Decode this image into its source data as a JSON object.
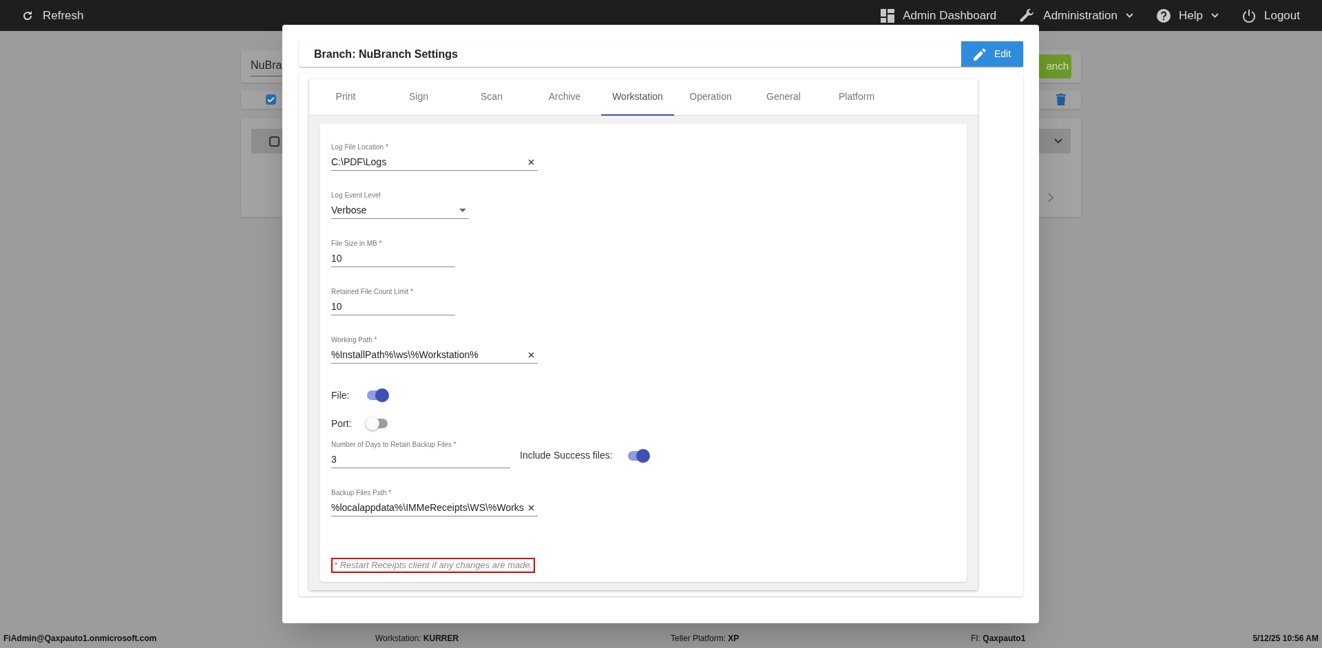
{
  "top_bar": {
    "refresh": "Refresh",
    "items": [
      {
        "kind": "dashboard",
        "label": "Admin Dashboard",
        "dropdown": false
      },
      {
        "kind": "wrench",
        "label": "Administration",
        "dropdown": true
      },
      {
        "kind": "help",
        "label": "Help",
        "dropdown": true
      },
      {
        "kind": "power",
        "label": "Logout",
        "dropdown": false
      }
    ]
  },
  "background": {
    "search_value": "NuBra",
    "button_label": "anch",
    "select_all_checked": true,
    "row_checked": false
  },
  "dialog": {
    "title": "Branch: NuBranch Settings",
    "edit_button": "Edit",
    "tabs": [
      {
        "label": "Print",
        "selected": false
      },
      {
        "label": "Sign",
        "selected": false
      },
      {
        "label": "Scan",
        "selected": false
      },
      {
        "label": "Archive",
        "selected": false
      },
      {
        "label": "Workstation",
        "selected": true
      },
      {
        "label": "Operation",
        "selected": false
      },
      {
        "label": "General",
        "selected": false
      },
      {
        "label": "Platform",
        "selected": false
      }
    ],
    "fields": [
      {
        "kind": "path",
        "label": "Log File Location *",
        "value": "C:\\PDF\\Logs"
      },
      {
        "kind": "select",
        "label": "Log Event Level",
        "value": "Verbose"
      },
      {
        "kind": "number",
        "label": "File Size in MB *",
        "value": "10"
      },
      {
        "kind": "number",
        "label": "Retained File Count Limit *",
        "value": "10"
      },
      {
        "kind": "path",
        "label": "Working Path *",
        "value": "%InstallPath%\\ws\\%Workstation%"
      },
      {
        "kind": "toggle",
        "label": "File:",
        "on": true
      },
      {
        "kind": "toggle",
        "label": "Port:",
        "on": false
      },
      {
        "kind": "number",
        "label": "Number of Days to Retain Backup Files *",
        "value": "3",
        "side_toggle": {
          "label": "Include Success files:",
          "on": true
        }
      },
      {
        "kind": "path",
        "label": "Backup Files Path *",
        "value": "%localappdata%\\IMMeReceipts\\WS\\%Works"
      }
    ],
    "note": "* Restart Receipts client if any changes are made."
  },
  "status_bar": [
    {
      "kind": "user",
      "text": "FiAdmin@Qaxpauto1.onmicrosoft.com"
    },
    {
      "kind": "info",
      "text": "Workstation: **KURRER**"
    },
    {
      "kind": "info",
      "text": "Teller Platform: **XP**"
    },
    {
      "kind": "info",
      "text": "FI: **Qaxpauto1**"
    },
    {
      "kind": "user",
      "text": "5/12/25 10:56 AM"
    }
  ]
}
